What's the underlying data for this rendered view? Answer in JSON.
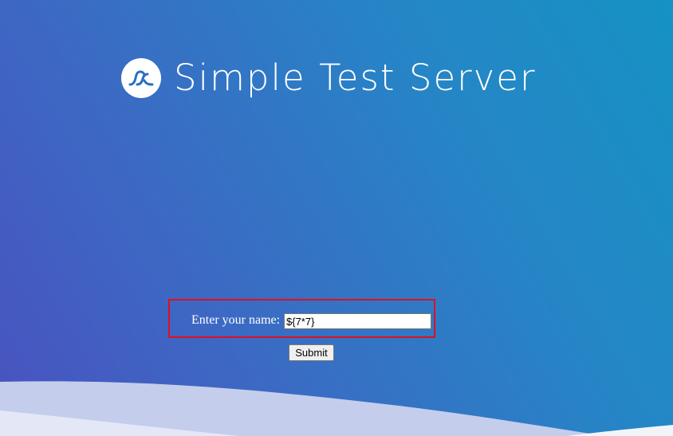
{
  "header": {
    "logo_icon": "wave-logo-icon",
    "title": "Simple Test Server"
  },
  "form": {
    "label": "Enter your name:",
    "input_value": "${7*7}",
    "submit_label": "Submit",
    "highlight_color": "#e0101e"
  },
  "colors": {
    "background_start": "#4a52c0",
    "background_end": "#1592c4",
    "text": "#ffffff"
  }
}
